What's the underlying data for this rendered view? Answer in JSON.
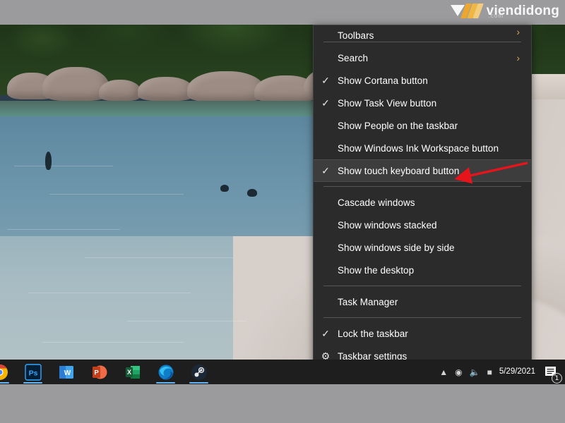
{
  "watermark": {
    "brand": "viendidong",
    "suffix": ".com",
    "icon": "viendidong-logo-icon"
  },
  "context_menu": {
    "title": "Taskbar context menu",
    "items": [
      {
        "label": "Toolbars",
        "checked": false,
        "submenu": true,
        "icon": null,
        "clipped": true,
        "highlighted": false,
        "separator_after": true
      },
      {
        "label": "Search",
        "checked": false,
        "submenu": true,
        "icon": null,
        "clipped": false,
        "highlighted": false,
        "separator_after": false
      },
      {
        "label": "Show Cortana button",
        "checked": true,
        "submenu": false,
        "icon": null,
        "clipped": false,
        "highlighted": false,
        "separator_after": false
      },
      {
        "label": "Show Task View button",
        "checked": true,
        "submenu": false,
        "icon": null,
        "clipped": false,
        "highlighted": false,
        "separator_after": false
      },
      {
        "label": "Show People on the taskbar",
        "checked": false,
        "submenu": false,
        "icon": null,
        "clipped": false,
        "highlighted": false,
        "separator_after": false
      },
      {
        "label": "Show Windows Ink Workspace button",
        "checked": false,
        "submenu": false,
        "icon": null,
        "clipped": false,
        "highlighted": false,
        "separator_after": false
      },
      {
        "label": "Show touch keyboard button",
        "checked": true,
        "submenu": false,
        "icon": null,
        "clipped": false,
        "highlighted": true,
        "separator_after": true
      },
      {
        "label": "Cascade windows",
        "checked": false,
        "submenu": false,
        "icon": null,
        "clipped": false,
        "highlighted": false,
        "separator_after": false
      },
      {
        "label": "Show windows stacked",
        "checked": false,
        "submenu": false,
        "icon": null,
        "clipped": false,
        "highlighted": false,
        "separator_after": false
      },
      {
        "label": "Show windows side by side",
        "checked": false,
        "submenu": false,
        "icon": null,
        "clipped": false,
        "highlighted": false,
        "separator_after": false
      },
      {
        "label": "Show the desktop",
        "checked": false,
        "submenu": false,
        "icon": null,
        "clipped": false,
        "highlighted": false,
        "separator_after": true
      },
      {
        "label": "Task Manager",
        "checked": false,
        "submenu": false,
        "icon": null,
        "clipped": false,
        "highlighted": false,
        "separator_after": true
      },
      {
        "label": "Lock the taskbar",
        "checked": true,
        "submenu": false,
        "icon": null,
        "clipped": false,
        "highlighted": false,
        "separator_after": false
      },
      {
        "label": "Taskbar settings",
        "checked": false,
        "submenu": false,
        "icon": "gear-icon",
        "clipped": false,
        "highlighted": false,
        "separator_after": false
      }
    ],
    "check_glyph": "✓",
    "submenu_glyph": "›",
    "gear_glyph": "⚙",
    "colors": {
      "background": "#2b2b2b",
      "highlight": "#3d3d3d",
      "text": "#ffffff",
      "separator": "#555555",
      "submenu_arrow": "#d6a858"
    }
  },
  "annotation": {
    "type": "red-arrow",
    "color": "#e8141c",
    "points_to": "Show touch keyboard button"
  },
  "taskbar": {
    "pinned_apps": [
      {
        "name": "chrome-icon",
        "label": "Google Chrome",
        "running": true
      },
      {
        "name": "photoshop-icon",
        "label": "Adobe Photoshop",
        "running": true,
        "text": "Ps"
      },
      {
        "name": "word-icon",
        "label": "Microsoft Word",
        "running": false,
        "text": "W"
      },
      {
        "name": "powerpoint-icon",
        "label": "Microsoft PowerPoint",
        "running": false,
        "text": "P"
      },
      {
        "name": "excel-icon",
        "label": "Microsoft Excel",
        "running": false,
        "text": "X"
      },
      {
        "name": "edge-icon",
        "label": "Microsoft Edge",
        "running": true
      },
      {
        "name": "steam-icon",
        "label": "Steam",
        "running": true
      }
    ],
    "tray": {
      "icons": [
        "chevron-up-icon",
        "network-icon",
        "volume-icon",
        "battery-icon"
      ],
      "date": "5/29/2021",
      "notification_count": "1"
    }
  },
  "wallpaper": {
    "description": "tropical beach with rocks, trees, turquoise water and sand shoreline"
  }
}
